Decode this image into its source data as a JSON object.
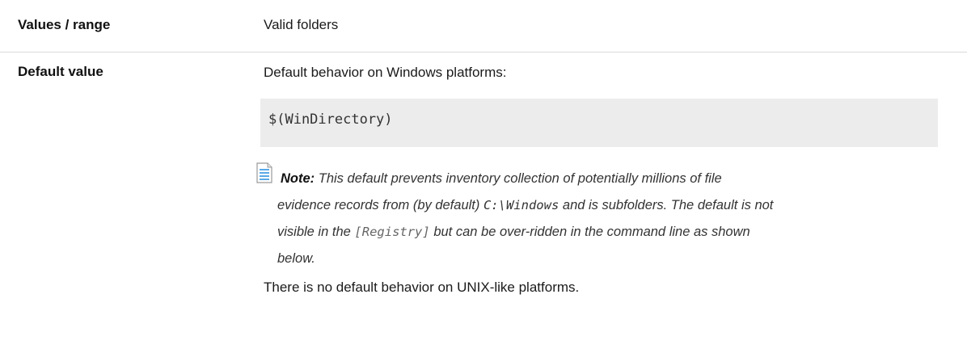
{
  "rows": [
    {
      "label": "Values / range",
      "value": "Valid folders"
    },
    {
      "label": "Default value",
      "intro": "Default behavior on Windows platforms:",
      "code": "$(WinDirectory)",
      "note": {
        "icon": "note-document-icon",
        "label": "Note:",
        "text_1": "This default prevents inventory collection of potentially millions of file",
        "text_2": "evidence records from (by default)",
        "code_1": "C:\\Windows",
        "text_3": "and is subfolders. The default is not",
        "text_4": "visible in the",
        "code_2": "[Registry]",
        "text_5": "but can be over-ridden in the command line as shown",
        "text_6": "below."
      },
      "outro": "There is no default behavior on UNIX-like platforms."
    }
  ]
}
